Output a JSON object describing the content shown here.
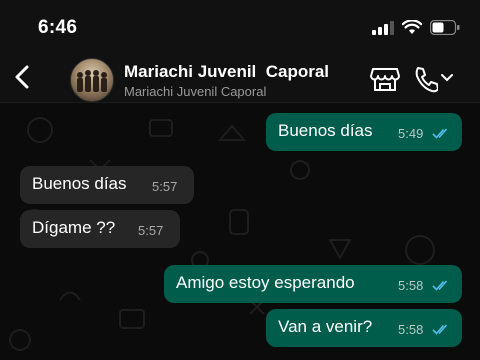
{
  "status": {
    "time": "6:46"
  },
  "header": {
    "title": "Mariachi Juvenil  Caporal",
    "subtitle": "Mariachi Juvenil Caporal"
  },
  "messages": [
    {
      "direction": "out",
      "text": "Buenos días",
      "time": "5:49",
      "read": true
    },
    {
      "direction": "in",
      "text": "Buenos días",
      "time": "5:57"
    },
    {
      "direction": "in",
      "text": "Dígame ??",
      "time": "5:57"
    },
    {
      "direction": "out",
      "text": "Amigo estoy esperando",
      "time": "5:58",
      "read": true
    },
    {
      "direction": "out",
      "text": "Van a venir?",
      "time": "5:58",
      "read": true
    }
  ],
  "colors": {
    "outgoing": "#005c4b",
    "incoming": "#262626",
    "read_ticks": "#53bdeb"
  }
}
